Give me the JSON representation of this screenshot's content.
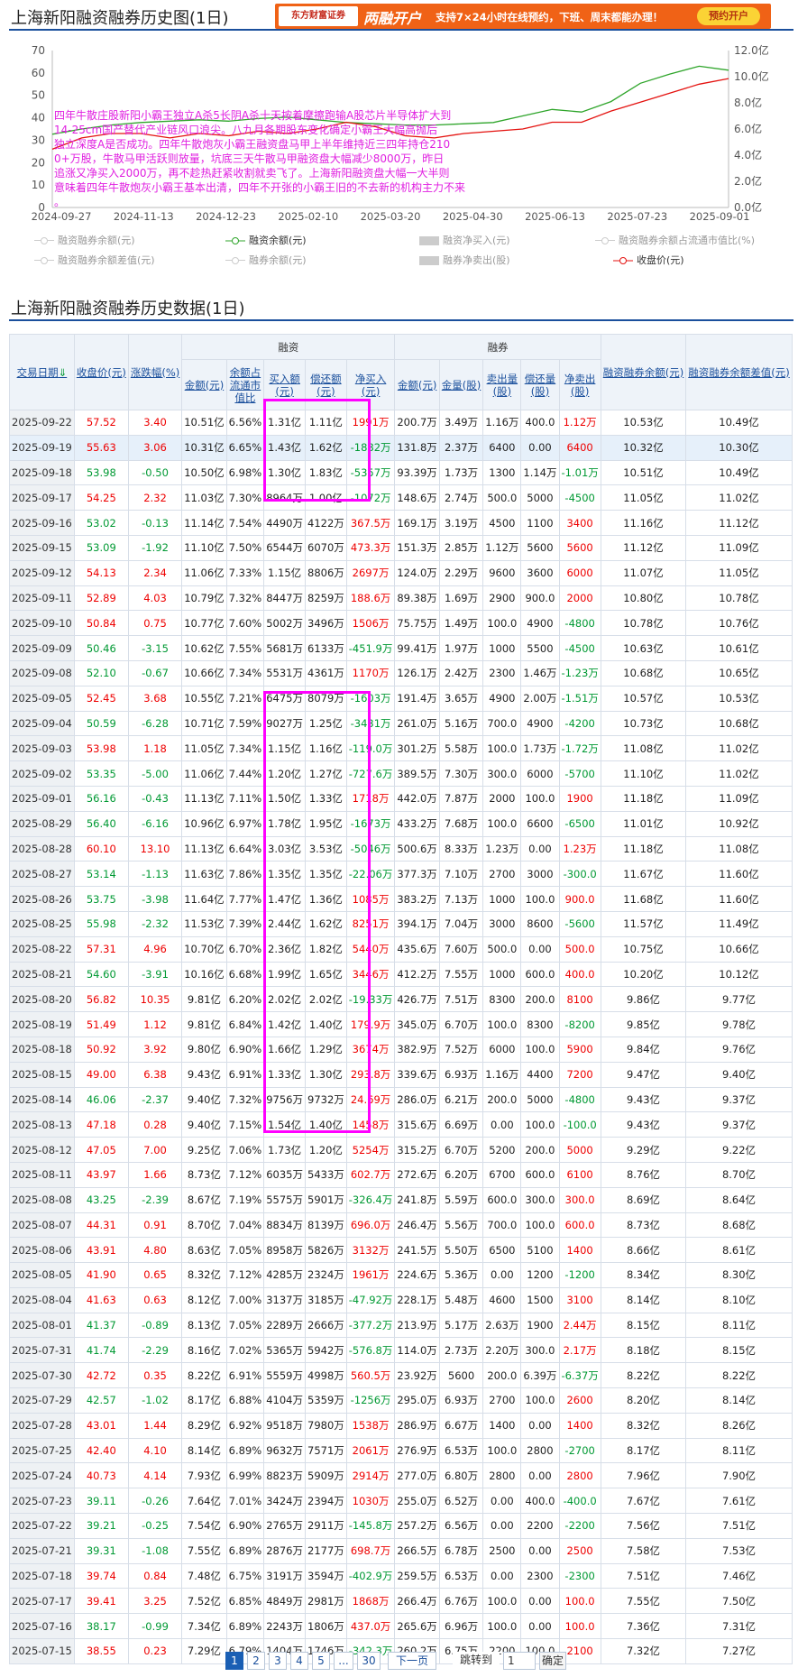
{
  "chart_title": "上海新阳融资融券历史图(1日)",
  "banner": {
    "logo": "东方财富证券",
    "big": "两融开户",
    "small": "支持7×24小时在线预约，下班、周末都能办理！",
    "btn": "预约开户"
  },
  "chart_data": {
    "type": "line",
    "title": "上海新阳融资融券历史图(1日)",
    "x": [
      "2024-09-27",
      "2024-11-13",
      "2024-12-23",
      "2025-02-10",
      "2025-03-20",
      "2025-04-30",
      "2025-06-13",
      "2025-07-23",
      "2025-09-01"
    ],
    "y_left_ticks": [
      "70",
      "60",
      "50",
      "40",
      "30",
      "20",
      "10",
      "0"
    ],
    "y_right_ticks": [
      "12.0亿",
      "10.0亿",
      "8.0亿",
      "6.0亿",
      "4.0亿",
      "2.0亿",
      "0.0亿"
    ],
    "ylim_left": [
      0,
      70
    ],
    "ylim_right": [
      0,
      12
    ],
    "series": [
      {
        "name": "融资余额(元)",
        "color": "#2fa52b",
        "axis": "right",
        "values": [
          5.6,
          6.0,
          6.3,
          6.5,
          6.6,
          6.7,
          6.6,
          6.8,
          6.9,
          6.7,
          6.5,
          6.4,
          6.3,
          6.3,
          6.4,
          6.5,
          7.0,
          7.5,
          7.3,
          8.1,
          9.5,
          10.2,
          10.8,
          10.5
        ]
      },
      {
        "name": "收盘价(元)",
        "color": "#e4120f",
        "axis": "left",
        "values": [
          26,
          31,
          33,
          33,
          31,
          33,
          32,
          34,
          33,
          35,
          38,
          36,
          32,
          31,
          33,
          34,
          35,
          38,
          38,
          43,
          47,
          51,
          55,
          57.5
        ]
      }
    ],
    "legend": [
      {
        "label": "融资融券余额(元)",
        "type": "line",
        "active": false
      },
      {
        "label": "融资余额(元)",
        "type": "line",
        "active": true,
        "color": "#2fa52b"
      },
      {
        "label": "融资净买入(元)",
        "type": "bar",
        "active": false
      },
      {
        "label": "融资融券余额占流通市值比(%)",
        "type": "line",
        "active": false
      },
      {
        "label": "融资融券余额差值(元)",
        "type": "line",
        "active": false
      },
      {
        "label": "融券余额(元)",
        "type": "line",
        "active": false
      },
      {
        "label": "融券净卖出(股)",
        "type": "bar",
        "active": false
      },
      {
        "label": "收盘价(元)",
        "type": "line",
        "active": true,
        "color": "#e4120f"
      }
    ],
    "annotation": "四年牛散庄股新阳小霸王独立A杀5长阴A杀十天按着摩擦跑输A股芯片半导体扩大到14-25cm国产替代产业链风口浪尖。八九月各期股东变化确定小霸王大幅高抛后独立深度A是否成功。四年牛散炮灰小霸王融资盘马甲上半年维持近三四年持仓2100+万股，牛散马甲活跃则放量，坑底三天牛散马甲融资盘大幅减少8000万，昨日追涨又净买入2000万，再不趁热赶紧收割就卖飞了。上海新阳融资盘大幅一大半则意味着四年牛散炮灰小霸王基本出清，四年不开张的小霸王旧的不去新的机构主力不来。"
  },
  "table_title": "上海新阳融资融券历史数据(1日)",
  "headers": {
    "date": "交易日期",
    "close": "收盘价(元)",
    "chg": "涨跌幅(%)",
    "rz": "融资",
    "rq": "融券",
    "rz_bal": "金额(元)",
    "rz_ratio": "余额占流通市值比",
    "rz_buy": "买入额(元)",
    "rz_repay": "偿还额(元)",
    "rz_net": "净买入(元)",
    "rq_bal": "金额(元)",
    "rq_vol": "金量(股)",
    "rq_sell": "卖出量(股)",
    "rq_repay": "偿还量(股)",
    "rq_net": "净卖出(股)",
    "total": "融资融券余额(元)",
    "diff": "融资融券余额差值(元)"
  },
  "rows": [
    [
      "2025-09-22",
      "57.52",
      "3.40",
      "10.51亿",
      "6.56%",
      "1.31亿",
      "1.11亿",
      "1991万",
      "200.7万",
      "3.49万",
      "1.16万",
      "400.0",
      "1.12万",
      "10.53亿",
      "10.49亿"
    ],
    [
      "2025-09-19",
      "55.63",
      "3.06",
      "10.31亿",
      "6.65%",
      "1.43亿",
      "1.62亿",
      "-1882万",
      "131.8万",
      "2.37万",
      "6400",
      "0.00",
      "6400",
      "10.32亿",
      "10.30亿"
    ],
    [
      "2025-09-18",
      "53.98",
      "-0.50",
      "10.50亿",
      "6.98%",
      "1.30亿",
      "1.83亿",
      "-5357万",
      "93.39万",
      "1.73万",
      "1300",
      "1.14万",
      "-1.01万",
      "10.51亿",
      "10.49亿"
    ],
    [
      "2025-09-17",
      "54.25",
      "2.32",
      "11.03亿",
      "7.30%",
      "8964万",
      "1.00亿",
      "-1072万",
      "148.6万",
      "2.74万",
      "500.0",
      "5000",
      "-4500",
      "11.05亿",
      "11.02亿"
    ],
    [
      "2025-09-16",
      "53.02",
      "-0.13",
      "11.14亿",
      "7.54%",
      "4490万",
      "4122万",
      "367.5万",
      "169.1万",
      "3.19万",
      "4500",
      "1100",
      "3400",
      "11.16亿",
      "11.12亿"
    ],
    [
      "2025-09-15",
      "53.09",
      "-1.92",
      "11.10亿",
      "7.50%",
      "6544万",
      "6070万",
      "473.3万",
      "151.3万",
      "2.85万",
      "1.12万",
      "5600",
      "5600",
      "11.12亿",
      "11.09亿"
    ],
    [
      "2025-09-12",
      "54.13",
      "2.34",
      "11.06亿",
      "7.33%",
      "1.15亿",
      "8806万",
      "2697万",
      "124.0万",
      "2.29万",
      "9600",
      "3600",
      "6000",
      "11.07亿",
      "11.05亿"
    ],
    [
      "2025-09-11",
      "52.89",
      "4.03",
      "10.79亿",
      "7.32%",
      "8447万",
      "8259万",
      "188.6万",
      "89.38万",
      "1.69万",
      "2900",
      "900.0",
      "2000",
      "10.80亿",
      "10.78亿"
    ],
    [
      "2025-09-10",
      "50.84",
      "0.75",
      "10.77亿",
      "7.60%",
      "5002万",
      "3496万",
      "1506万",
      "75.75万",
      "1.49万",
      "100.0",
      "4900",
      "-4800",
      "10.78亿",
      "10.76亿"
    ],
    [
      "2025-09-09",
      "50.46",
      "-3.15",
      "10.62亿",
      "7.55%",
      "5681万",
      "6133万",
      "-451.9万",
      "99.41万",
      "1.97万",
      "1000",
      "5500",
      "-4500",
      "10.63亿",
      "10.61亿"
    ],
    [
      "2025-09-08",
      "52.10",
      "-0.67",
      "10.66亿",
      "7.34%",
      "5531万",
      "4361万",
      "1170万",
      "126.1万",
      "2.42万",
      "2300",
      "1.46万",
      "-1.23万",
      "10.68亿",
      "10.65亿"
    ],
    [
      "2025-09-05",
      "52.45",
      "3.68",
      "10.55亿",
      "7.21%",
      "6475万",
      "8079万",
      "-1603万",
      "191.4万",
      "3.65万",
      "4900",
      "2.00万",
      "-1.51万",
      "10.57亿",
      "10.53亿"
    ],
    [
      "2025-09-04",
      "50.59",
      "-6.28",
      "10.71亿",
      "7.59%",
      "9027万",
      "1.25亿",
      "-3431万",
      "261.0万",
      "5.16万",
      "700.0",
      "4900",
      "-4200",
      "10.73亿",
      "10.68亿"
    ],
    [
      "2025-09-03",
      "53.98",
      "1.18",
      "11.05亿",
      "7.34%",
      "1.15亿",
      "1.16亿",
      "-119.0万",
      "301.2万",
      "5.58万",
      "100.0",
      "1.73万",
      "-1.72万",
      "11.08亿",
      "11.02亿"
    ],
    [
      "2025-09-02",
      "53.35",
      "-5.00",
      "11.06亿",
      "7.44%",
      "1.20亿",
      "1.27亿",
      "-727.6万",
      "389.5万",
      "7.30万",
      "300.0",
      "6000",
      "-5700",
      "11.10亿",
      "11.02亿"
    ],
    [
      "2025-09-01",
      "56.16",
      "-0.43",
      "11.13亿",
      "7.11%",
      "1.50亿",
      "1.33亿",
      "1718万",
      "442.0万",
      "7.87万",
      "2000",
      "100.0",
      "1900",
      "11.18亿",
      "11.09亿"
    ],
    [
      "2025-08-29",
      "56.40",
      "-6.16",
      "10.96亿",
      "6.97%",
      "1.78亿",
      "1.95亿",
      "-1673万",
      "433.2万",
      "7.68万",
      "100.0",
      "6600",
      "-6500",
      "11.01亿",
      "10.92亿"
    ],
    [
      "2025-08-28",
      "60.10",
      "13.10",
      "11.13亿",
      "6.64%",
      "3.03亿",
      "3.53亿",
      "-5046万",
      "500.6万",
      "8.33万",
      "1.23万",
      "0.00",
      "1.23万",
      "11.18亿",
      "11.08亿"
    ],
    [
      "2025-08-27",
      "53.14",
      "-1.13",
      "11.63亿",
      "7.86%",
      "1.35亿",
      "1.35亿",
      "-22.06万",
      "377.3万",
      "7.10万",
      "2700",
      "3000",
      "-300.0",
      "11.67亿",
      "11.60亿"
    ],
    [
      "2025-08-26",
      "53.75",
      "-3.98",
      "11.64亿",
      "7.77%",
      "1.47亿",
      "1.36亿",
      "1085万",
      "383.2万",
      "7.13万",
      "1000",
      "100.0",
      "900.0",
      "11.68亿",
      "11.60亿"
    ],
    [
      "2025-08-25",
      "55.98",
      "-2.32",
      "11.53亿",
      "7.39%",
      "2.44亿",
      "1.62亿",
      "8251万",
      "394.1万",
      "7.04万",
      "3000",
      "8600",
      "-5600",
      "11.57亿",
      "11.49亿"
    ],
    [
      "2025-08-22",
      "57.31",
      "4.96",
      "10.70亿",
      "6.70%",
      "2.36亿",
      "1.82亿",
      "5440万",
      "435.6万",
      "7.60万",
      "500.0",
      "0.00",
      "500.0",
      "10.75亿",
      "10.66亿"
    ],
    [
      "2025-08-21",
      "54.60",
      "-3.91",
      "10.16亿",
      "6.68%",
      "1.99亿",
      "1.65亿",
      "3446万",
      "412.2万",
      "7.55万",
      "1000",
      "600.0",
      "400.0",
      "10.20亿",
      "10.12亿"
    ],
    [
      "2025-08-20",
      "56.82",
      "10.35",
      "9.81亿",
      "6.20%",
      "2.02亿",
      "2.02亿",
      "-19.33万",
      "426.7万",
      "7.51万",
      "8300",
      "200.0",
      "8100",
      "9.86亿",
      "9.77亿"
    ],
    [
      "2025-08-19",
      "51.49",
      "1.12",
      "9.81亿",
      "6.84%",
      "1.42亿",
      "1.40亿",
      "179.9万",
      "345.0万",
      "6.70万",
      "100.0",
      "8300",
      "-8200",
      "9.85亿",
      "9.78亿"
    ],
    [
      "2025-08-18",
      "50.92",
      "3.92",
      "9.80亿",
      "6.90%",
      "1.66亿",
      "1.29亿",
      "3674万",
      "382.9万",
      "7.52万",
      "6000",
      "100.0",
      "5900",
      "9.84亿",
      "9.76亿"
    ],
    [
      "2025-08-15",
      "49.00",
      "6.38",
      "9.43亿",
      "6.91%",
      "1.33亿",
      "1.30亿",
      "293.8万",
      "339.6万",
      "6.93万",
      "1.16万",
      "4400",
      "7200",
      "9.47亿",
      "9.40亿"
    ],
    [
      "2025-08-14",
      "46.06",
      "-2.37",
      "9.40亿",
      "7.32%",
      "9756万",
      "9732万",
      "24.69万",
      "286.0万",
      "6.21万",
      "200.0",
      "5000",
      "-4800",
      "9.43亿",
      "9.37亿"
    ],
    [
      "2025-08-13",
      "47.18",
      "0.28",
      "9.40亿",
      "7.15%",
      "1.54亿",
      "1.40亿",
      "1458万",
      "315.6万",
      "6.69万",
      "0.00",
      "100.0",
      "-100.0",
      "9.43亿",
      "9.37亿"
    ],
    [
      "2025-08-12",
      "47.05",
      "7.00",
      "9.25亿",
      "7.06%",
      "1.73亿",
      "1.20亿",
      "5254万",
      "315.2万",
      "6.70万",
      "5200",
      "200.0",
      "5000",
      "9.29亿",
      "9.22亿"
    ],
    [
      "2025-08-11",
      "43.97",
      "1.66",
      "8.73亿",
      "7.12%",
      "6035万",
      "5433万",
      "602.7万",
      "272.6万",
      "6.20万",
      "6700",
      "600.0",
      "6100",
      "8.76亿",
      "8.70亿"
    ],
    [
      "2025-08-08",
      "43.25",
      "-2.39",
      "8.67亿",
      "7.19%",
      "5575万",
      "5901万",
      "-326.4万",
      "241.8万",
      "5.59万",
      "600.0",
      "300.0",
      "300.0",
      "8.69亿",
      "8.64亿"
    ],
    [
      "2025-08-07",
      "44.31",
      "0.91",
      "8.70亿",
      "7.04%",
      "8834万",
      "8139万",
      "696.0万",
      "246.4万",
      "5.56万",
      "700.0",
      "100.0",
      "600.0",
      "8.73亿",
      "8.68亿"
    ],
    [
      "2025-08-06",
      "43.91",
      "4.80",
      "8.63亿",
      "7.05%",
      "8958万",
      "5826万",
      "3132万",
      "241.5万",
      "5.50万",
      "6500",
      "5100",
      "1400",
      "8.66亿",
      "8.61亿"
    ],
    [
      "2025-08-05",
      "41.90",
      "0.65",
      "8.32亿",
      "7.12%",
      "4285万",
      "2324万",
      "1961万",
      "224.6万",
      "5.36万",
      "0.00",
      "1200",
      "-1200",
      "8.34亿",
      "8.30亿"
    ],
    [
      "2025-08-04",
      "41.63",
      "0.63",
      "8.12亿",
      "7.00%",
      "3137万",
      "3185万",
      "-47.92万",
      "228.1万",
      "5.48万",
      "4600",
      "1500",
      "3100",
      "8.14亿",
      "8.10亿"
    ],
    [
      "2025-08-01",
      "41.37",
      "-0.89",
      "8.13亿",
      "7.05%",
      "2289万",
      "2666万",
      "-377.2万",
      "213.9万",
      "5.17万",
      "2.63万",
      "1900",
      "2.44万",
      "8.15亿",
      "8.11亿"
    ],
    [
      "2025-07-31",
      "41.74",
      "-2.29",
      "8.16亿",
      "7.02%",
      "5365万",
      "5942万",
      "-576.8万",
      "114.0万",
      "2.73万",
      "2.20万",
      "300.0",
      "2.17万",
      "8.18亿",
      "8.15亿"
    ],
    [
      "2025-07-30",
      "42.72",
      "0.35",
      "8.22亿",
      "6.91%",
      "5559万",
      "4998万",
      "560.5万",
      "23.92万",
      "5600",
      "200.0",
      "6.39万",
      "-6.37万",
      "8.22亿",
      "8.22亿"
    ],
    [
      "2025-07-29",
      "42.57",
      "-1.02",
      "8.17亿",
      "6.88%",
      "4104万",
      "5359万",
      "-1256万",
      "295.0万",
      "6.93万",
      "2700",
      "100.0",
      "2600",
      "8.20亿",
      "8.14亿"
    ],
    [
      "2025-07-28",
      "43.01",
      "1.44",
      "8.29亿",
      "6.92%",
      "9518万",
      "7980万",
      "1538万",
      "286.9万",
      "6.67万",
      "1400",
      "0.00",
      "1400",
      "8.32亿",
      "8.26亿"
    ],
    [
      "2025-07-25",
      "42.40",
      "4.10",
      "8.14亿",
      "6.89%",
      "9632万",
      "7571万",
      "2061万",
      "276.9万",
      "6.53万",
      "100.0",
      "2800",
      "-2700",
      "8.17亿",
      "8.11亿"
    ],
    [
      "2025-07-24",
      "40.73",
      "4.14",
      "7.93亿",
      "6.99%",
      "8823万",
      "5909万",
      "2914万",
      "277.0万",
      "6.80万",
      "2800",
      "0.00",
      "2800",
      "7.96亿",
      "7.90亿"
    ],
    [
      "2025-07-23",
      "39.11",
      "-0.26",
      "7.64亿",
      "7.01%",
      "3424万",
      "2394万",
      "1030万",
      "255.0万",
      "6.52万",
      "0.00",
      "400.0",
      "-400.0",
      "7.67亿",
      "7.61亿"
    ],
    [
      "2025-07-22",
      "39.21",
      "-0.25",
      "7.54亿",
      "6.90%",
      "2765万",
      "2911万",
      "-145.8万",
      "257.2万",
      "6.56万",
      "0.00",
      "2200",
      "-2200",
      "7.56亿",
      "7.51亿"
    ],
    [
      "2025-07-21",
      "39.31",
      "-1.08",
      "7.55亿",
      "6.89%",
      "2876万",
      "2177万",
      "698.7万",
      "266.5万",
      "6.78万",
      "2500",
      "0.00",
      "2500",
      "7.58亿",
      "7.53亿"
    ],
    [
      "2025-07-18",
      "39.74",
      "0.84",
      "7.48亿",
      "6.75%",
      "3191万",
      "3594万",
      "-402.9万",
      "259.5万",
      "6.53万",
      "0.00",
      "2300",
      "-2300",
      "7.51亿",
      "7.46亿"
    ],
    [
      "2025-07-17",
      "39.41",
      "3.25",
      "7.52亿",
      "6.85%",
      "4849万",
      "2981万",
      "1868万",
      "266.4万",
      "6.76万",
      "100.0",
      "0.00",
      "100.0",
      "7.55亿",
      "7.50亿"
    ],
    [
      "2025-07-16",
      "38.17",
      "-0.99",
      "7.34亿",
      "6.89%",
      "2243万",
      "1806万",
      "437.0万",
      "265.6万",
      "6.96万",
      "100.0",
      "0.00",
      "100.0",
      "7.36亿",
      "7.31亿"
    ],
    [
      "2025-07-15",
      "38.55",
      "0.23",
      "7.29亿",
      "6.79%",
      "1404万",
      "1746万",
      "-342.3万",
      "260.2万",
      "6.75万",
      "2200",
      "100.0",
      "2100",
      "7.32亿",
      "7.27亿"
    ]
  ],
  "pager": {
    "pages": [
      "1",
      "2",
      "3",
      "4",
      "5",
      "...",
      "30"
    ],
    "next": "下一页",
    "goto": "跳转到",
    "input": "1",
    "go": "确定"
  }
}
